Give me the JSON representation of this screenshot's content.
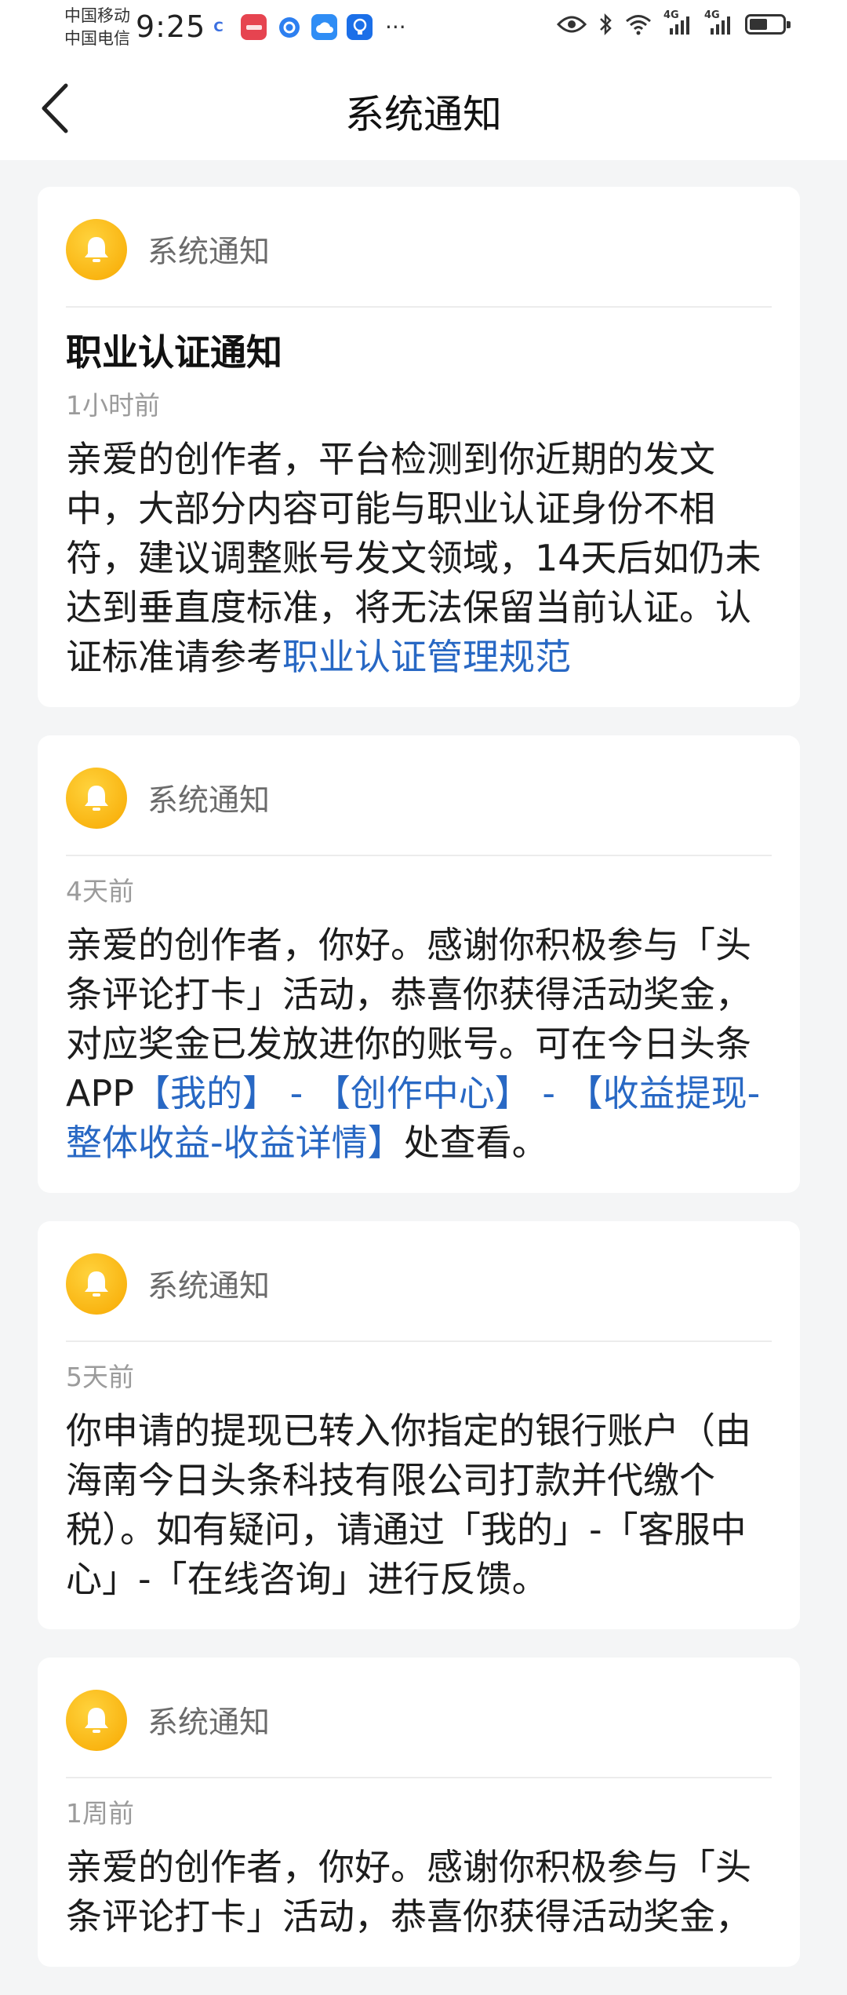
{
  "status_bar": {
    "carrier_1": "中国移动",
    "carrier_2": "中国电信",
    "time": "9:25",
    "apps": [
      {
        "icon": "c-app-icon",
        "color": "#ffffff",
        "glyph": "C",
        "fg": "#3a6fe0"
      },
      {
        "icon": "huawei-app-icon",
        "color": "#e64450",
        "glyph": "H",
        "fg": "#ffffff"
      },
      {
        "icon": "browser-app-icon",
        "color": "#2d7ff0",
        "glyph": "◉",
        "fg": "#ffffff"
      },
      {
        "icon": "cloud-app-icon",
        "color": "#2f8df5",
        "glyph": "☁",
        "fg": "#ffffff"
      },
      {
        "icon": "bulb-app-icon",
        "color": "#1b6fe8",
        "glyph": "✦",
        "fg": "#ffffff"
      }
    ],
    "more": "···",
    "network_1": "4G",
    "network_2": "4G",
    "battery_level": 0.55
  },
  "header": {
    "title": "系统通知"
  },
  "notifications": [
    {
      "source": "系统通知",
      "title": "职业认证通知",
      "time": "1小时前",
      "body_text": "亲爱的创作者，平台检测到你近期的发文中，大部分内容可能与职业认证身份不相符，建议调整账号发文领域，14天后如仍未达到垂直度标准，将无法保留当前认证。认证标准请参考",
      "body_link": "职业认证管理规范"
    },
    {
      "source": "系统通知",
      "time": "4天前",
      "body_text": "亲爱的创作者，你好。感谢你积极参与「头条评论打卡」活动，恭喜你获得活动奖金，对应奖金已发放进你的账号。可在今日头条APP",
      "body_link": "【我的】 - 【创作中心】 - 【收益提现-整体收益-收益详情】",
      "body_suffix": "处查看。"
    },
    {
      "source": "系统通知",
      "time": "5天前",
      "body_text": "你申请的提现已转入你指定的银行账户（由海南今日头条科技有限公司打款并代缴个税）。如有疑问，请通过「我的」-「客服中心」-「在线咨询」进行反馈。"
    },
    {
      "source": "系统通知",
      "time": "1周前",
      "body_text": "亲爱的创作者，你好。感谢你积极参与「头条评论打卡」活动，恭喜你获得活动奖金，"
    }
  ],
  "colors": {
    "bell": "#f7b500",
    "link": "#2868c4",
    "page_bg": "#f4f5f6"
  }
}
